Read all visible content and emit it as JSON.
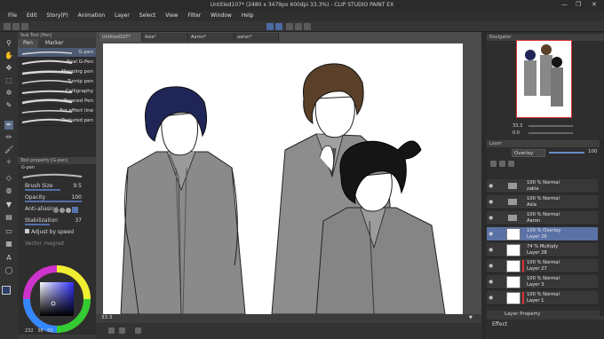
{
  "window": {
    "title": "Untitled107* (2480 x 3479px 600dpi 33.3%) - CLIP STUDIO PAINT EX",
    "controls": [
      "—",
      "❐",
      "✕"
    ]
  },
  "menu": [
    "File",
    "Edit",
    "Story(P)",
    "Animation",
    "Layer",
    "Select",
    "View",
    "Filter",
    "Window",
    "Help"
  ],
  "subtool": {
    "header": "Sub Tool [Pen]",
    "tabs": [
      "Pen",
      "Marker"
    ],
    "brushes": [
      "G-pen",
      "Real G-Pen",
      "Mapping pen",
      "Turnip pen",
      "Calligraphy",
      "Tapered Pen",
      "For effect line",
      "Textured pen"
    ],
    "selected_brush": "G-pen"
  },
  "tool_property": {
    "header": "Tool property [G-pen]",
    "name": "G-pen",
    "brush_size_label": "Brush Size",
    "brush_size_value": "9.5",
    "opacity_label": "Opacity",
    "opacity_value": "100",
    "anti_alias_label": "Anti-aliasing",
    "stabilization_label": "Stabilization",
    "stabilization_value": "37",
    "adjust_label": "Adjust by speed",
    "vector_label": "Vector magnet"
  },
  "color": {
    "values": [
      "232",
      "36",
      "50"
    ],
    "fg_color": "#2d3e6b",
    "bg_color": "#ffffff"
  },
  "document_tabs": [
    "Untitled107*",
    "Asla*",
    "Aaron*",
    "aaron*"
  ],
  "status": {
    "zoom": "33.3",
    "zoom_right": "33.3"
  },
  "navigator": {
    "title": "Navigator",
    "zoom": "33.3",
    "angle": "0.0"
  },
  "layer_panel": {
    "title": "Layer",
    "blend_mode": "Overlay",
    "opacity": "100",
    "footer_tabs": [
      "Layer Property"
    ],
    "effect_label": "Effect",
    "layers": [
      {
        "l1": "100 % Normal",
        "l2": "zakie",
        "kind": "folder",
        "selected": false,
        "red": false
      },
      {
        "l1": "100 % Normal",
        "l2": "Asla",
        "kind": "folder",
        "selected": false,
        "red": false
      },
      {
        "l1": "100 % Normal",
        "l2": "Aaron",
        "kind": "folder",
        "selected": false,
        "red": false
      },
      {
        "l1": "100 % Overlay",
        "l2": "Layer 26",
        "kind": "layer",
        "selected": true,
        "red": false
      },
      {
        "l1": "74 % Multiply",
        "l2": "Layer 28",
        "kind": "layer",
        "selected": false,
        "red": false
      },
      {
        "l1": "100 % Normal",
        "l2": "Layer 27",
        "kind": "layer",
        "selected": false,
        "red": true
      },
      {
        "l1": "100 % Normal",
        "l2": "Layer 3",
        "kind": "layer",
        "selected": false,
        "red": false
      },
      {
        "l1": "100 % Normal",
        "l2": "Layer 1",
        "kind": "layer",
        "selected": false,
        "red": true
      }
    ]
  }
}
